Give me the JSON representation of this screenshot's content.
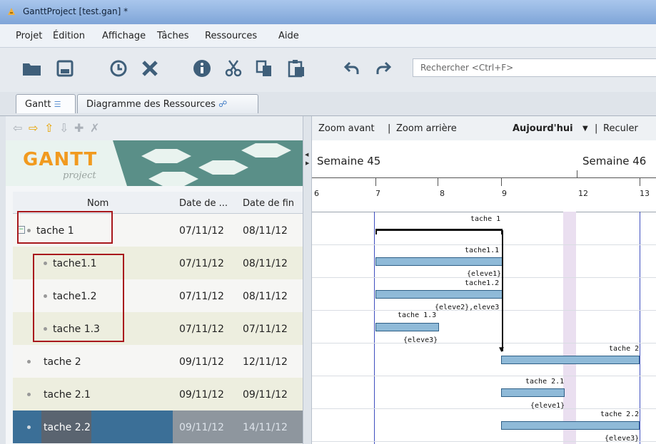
{
  "window": {
    "title": "GanttProject [test.gan] *"
  },
  "menu": [
    "Projet",
    "Édition",
    "Affichage",
    "Tâches",
    "Ressources",
    "Aide"
  ],
  "toolbar": {
    "icons": [
      "open-folder-icon",
      "save-icon",
      "history-icon",
      "delete-icon",
      "info-icon",
      "cut-icon",
      "copy-icon",
      "paste-icon",
      "undo-icon",
      "redo-icon"
    ],
    "search_placeholder": "Rechercher <Ctrl+F>"
  },
  "tabs": [
    {
      "label": "Gantt"
    },
    {
      "label": "Diagramme des Ressources"
    }
  ],
  "logo": {
    "text_main": "GANTT",
    "text_sub": "project"
  },
  "table": {
    "headers": {
      "name": "Nom",
      "start": "Date de ...",
      "end": "Date de fin"
    },
    "rows": [
      {
        "name": "tache 1",
        "start": "07/11/12",
        "end": "08/11/12",
        "level": 0,
        "expandable": true
      },
      {
        "name": "tache1.1",
        "start": "07/11/12",
        "end": "08/11/12",
        "level": 1
      },
      {
        "name": "tache1.2",
        "start": "07/11/12",
        "end": "08/11/12",
        "level": 1
      },
      {
        "name": "tache 1.3",
        "start": "07/11/12",
        "end": "07/11/12",
        "level": 1
      },
      {
        "name": "tache 2",
        "start": "09/11/12",
        "end": "12/11/12",
        "level": 0
      },
      {
        "name": "tache 2.1",
        "start": "09/11/12",
        "end": "09/11/12",
        "level": 0
      },
      {
        "name": "tache 2.2",
        "start": "09/11/12",
        "end": "14/11/12",
        "level": 0,
        "selected": true
      }
    ]
  },
  "gantt": {
    "toolbar": {
      "zoom_in": "Zoom avant",
      "separator": "|",
      "zoom_out": "Zoom arrière",
      "today": "Aujourd'hui",
      "back": "Reculer"
    },
    "weeks": [
      "Semaine 45",
      "Semaine 46"
    ],
    "days": [
      "6",
      "7",
      "8",
      "9",
      "12",
      "13"
    ],
    "bars": [
      {
        "label": "tache 1",
        "resource": ""
      },
      {
        "label": "tache1.1",
        "resource": "{eleve1}"
      },
      {
        "label": "tache1.2",
        "resource": "{eleve2},eleve3"
      },
      {
        "label": "tache 1.3",
        "resource": "{eleve3}"
      },
      {
        "label": "tache 2",
        "resource": ""
      },
      {
        "label": "tache 2.1",
        "resource": "{eleve1}"
      },
      {
        "label": "tache 2.2",
        "resource": "{eleve3}"
      }
    ]
  },
  "colors": {
    "accent": "#a8181c",
    "bar": "#8fbad8",
    "selection": "#3b6f97"
  }
}
